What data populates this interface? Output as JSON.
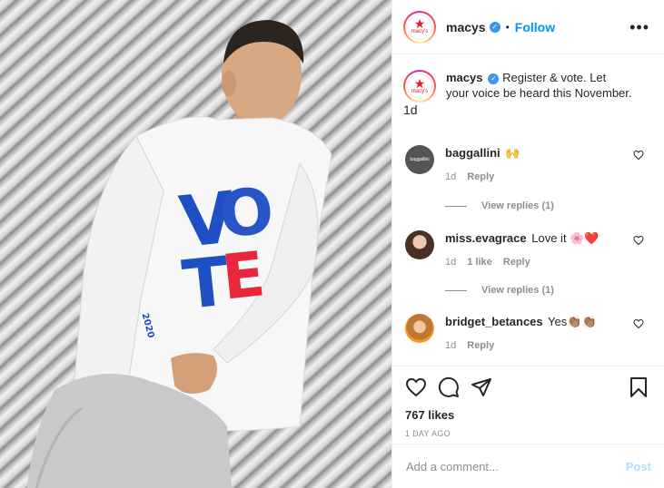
{
  "header": {
    "avatar_star": "★",
    "avatar_word": "macy's",
    "username": "macys",
    "verified_mark": "✓",
    "separator": "•",
    "follow_label": "Follow",
    "more_label": "•••"
  },
  "photo": {
    "shirt_text": "VOTE",
    "sleeve_text": "2020",
    "shirt_colors": {
      "blue": "#1f4fc4",
      "red": "#e8283a"
    }
  },
  "caption": {
    "username": "macys",
    "text": "Register & vote. Let your voice be heard this November.",
    "time": "1d"
  },
  "comments": [
    {
      "username": "baggallini",
      "text": "🙌",
      "avatar_text": "baggallini",
      "time": "1d",
      "likes": "",
      "reply": "Reply",
      "view_replies": "View replies (1)"
    },
    {
      "username": "miss.evagrace",
      "text": "Love it 🌸❤️",
      "time": "1d",
      "likes": "1 like",
      "reply": "Reply",
      "view_replies": "View replies (1)"
    },
    {
      "username": "bridget_betances",
      "text": "Yes👏🏽👏🏽",
      "time": "1d",
      "likes": "",
      "reply": "Reply"
    }
  ],
  "actions": {
    "likes": "767 likes",
    "age": "1 DAY AGO",
    "icons": [
      "heart-icon",
      "comment-icon",
      "share-icon",
      "bookmark-icon"
    ]
  },
  "add_comment": {
    "placeholder": "Add a comment...",
    "post_label": "Post"
  },
  "colors": {
    "link": "#0095f6",
    "secondary_text": "#8e8e8e",
    "border": "#efefef",
    "post_disabled": "#b2dffc"
  }
}
